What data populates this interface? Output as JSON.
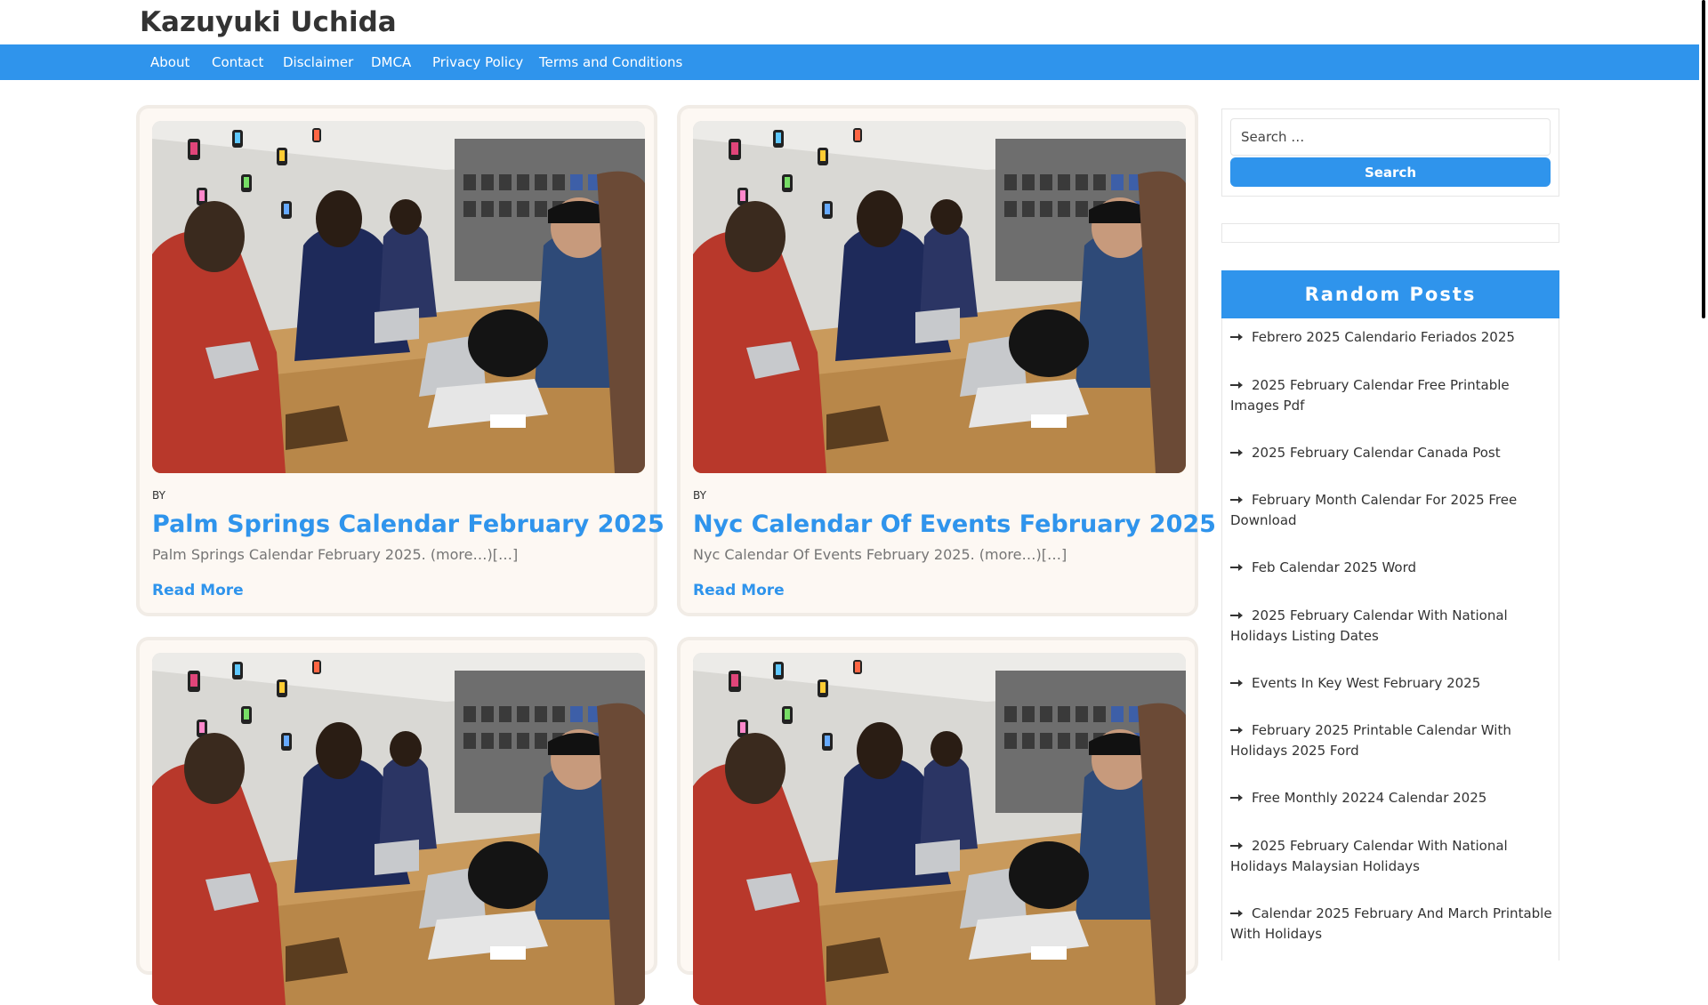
{
  "site": {
    "title": "Kazuyuki Uchida"
  },
  "nav": [
    "About",
    "Contact",
    "Disclaimer",
    "DMCA",
    "Privacy Policy",
    "Terms and Conditions"
  ],
  "posts": [
    {
      "by": "BY",
      "title": "Palm Springs Calendar February 2025",
      "excerpt": "Palm Springs Calendar February 2025. (more…)[…]",
      "read_more": "Read More"
    },
    {
      "by": "BY",
      "title": "Nyc Calendar Of Events February 2025",
      "excerpt": "Nyc Calendar Of Events February 2025. (more…)[…]",
      "read_more": "Read More"
    }
  ],
  "sidebar": {
    "search": {
      "placeholder": "Search …",
      "button": "Search"
    },
    "random_posts": {
      "title": "Random Posts",
      "items": [
        "Febrero 2025 Calendario Feriados 2025",
        "2025 February Calendar Free Printable Images Pdf",
        "2025 February Calendar Canada Post",
        "February Month Calendar For 2025 Free Download",
        "Feb Calendar 2025 Word",
        "2025 February Calendar With National Holidays Listing Dates",
        "Events In Key West February 2025",
        "February 2025 Printable Calendar With Holidays 2025 Ford",
        "Free Monthly 20224 Calendar 2025",
        "2025 February Calendar With National Holidays Malaysian Holidays",
        "Calendar 2025 February And March Printable With Holidays"
      ]
    }
  },
  "colors": {
    "accent": "#2f94ec",
    "card_bg": "#fdf8f3"
  }
}
